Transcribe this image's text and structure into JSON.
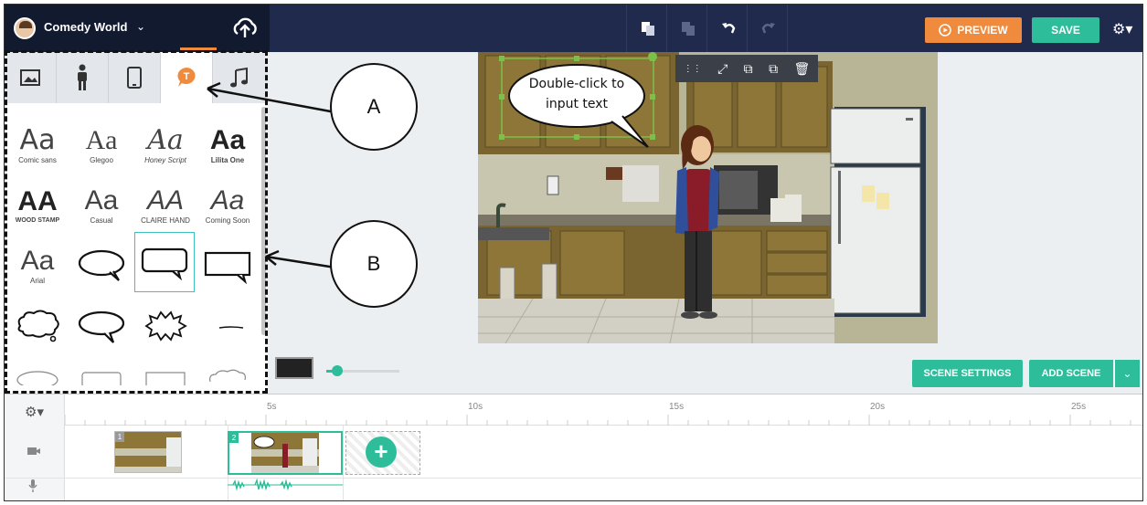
{
  "header": {
    "project_title": "Comedy World",
    "preview_label": "PREVIEW",
    "save_label": "SAVE"
  },
  "left_panel": {
    "tabs": [
      "image",
      "character",
      "prop",
      "text",
      "music"
    ],
    "active_tab": "text",
    "fonts": [
      {
        "glyph": "Aa",
        "name": "Comic sans"
      },
      {
        "glyph": "Aa",
        "name": "Glegoo"
      },
      {
        "glyph": "Aa",
        "name": "Honey Script"
      },
      {
        "glyph": "Aa",
        "name": "Lilita One"
      },
      {
        "glyph": "AA",
        "name": "WOOD STAMP"
      },
      {
        "glyph": "Aa",
        "name": "Casual"
      },
      {
        "glyph": "AA",
        "name": "CLAIRE HAND"
      },
      {
        "glyph": "Aa",
        "name": "Coming Soon"
      },
      {
        "glyph": "Aa",
        "name": "Arial"
      }
    ]
  },
  "canvas": {
    "speech_bubble_text": "Double-click to input text"
  },
  "callouts": {
    "a": "A",
    "b": "B"
  },
  "scene_controls": {
    "scene_settings_label": "SCENE SETTINGS",
    "add_scene_label": "ADD SCENE"
  },
  "timeline": {
    "ticks": [
      "5s",
      "10s",
      "15s",
      "20s",
      "25s"
    ],
    "scenes": [
      {
        "number": "1",
        "bubble_text": ""
      },
      {
        "number": "2",
        "bubble_text": "Double-click to input text"
      }
    ]
  },
  "colors": {
    "topbar": "#1f2a4d",
    "accent_green": "#2dbd9a",
    "accent_orange": "#f08a3c"
  }
}
